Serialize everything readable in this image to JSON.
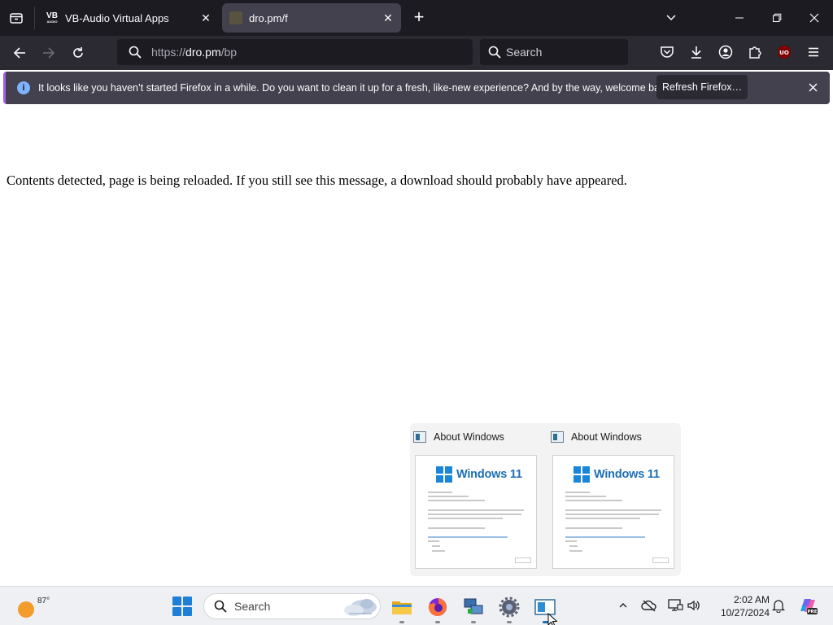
{
  "browser": {
    "tabs": [
      {
        "title": "VB-Audio Virtual Apps",
        "favicon": "vb-audio-logo",
        "active": false
      },
      {
        "title": "dro.pm/f",
        "favicon": "dro-pm-icon",
        "active": true
      }
    ],
    "address": {
      "scheme": "https://",
      "host": "dro.pm",
      "path": "/bp"
    },
    "search_placeholder": "Search",
    "notification": {
      "message": "It looks like you haven’t started Firefox in a while. Do you want to clean it up for a fresh, like-new experience? And by the way, welcome back!",
      "button_label": "Refresh Firefox…"
    }
  },
  "page": {
    "message": "Contents detected, page is being reloaded. If you still see this message, a download should probably have appeared."
  },
  "thumbnails": [
    {
      "title": "About Windows",
      "preview_brand": "Windows 11"
    },
    {
      "title": "About Windows",
      "preview_brand": "Windows 11"
    }
  ],
  "taskbar": {
    "weather_temp": "87°",
    "search_label": "Search",
    "time": "2:02 AM",
    "date": "10/27/2024"
  },
  "colors": {
    "tab_bar": "#1c1b22",
    "nav_bar": "#2b2a33",
    "notification_accent": "#a55cf0",
    "windows_blue": "#1a86d9"
  }
}
